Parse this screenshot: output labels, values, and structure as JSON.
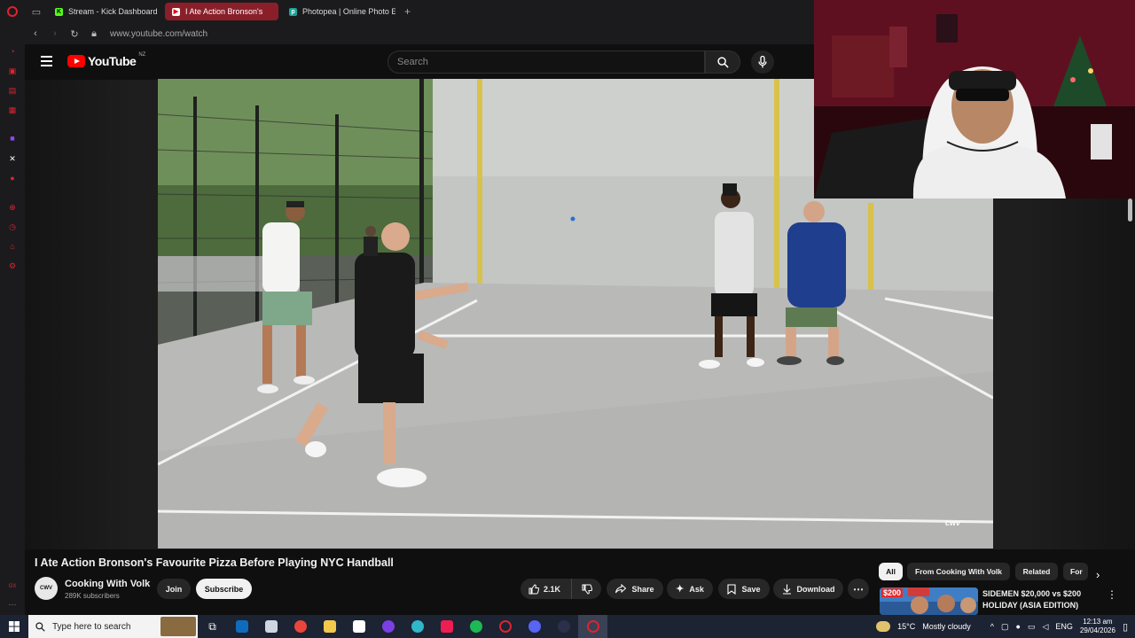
{
  "browser": {
    "tabs": [
      {
        "label": "Stream - Kick Dashboard",
        "icon": "kick-icon",
        "active": false
      },
      {
        "label": "I Ate Action Bronson's",
        "icon": "youtube-icon",
        "active": true
      },
      {
        "label": "Photopea | Online Photo E",
        "icon": "photopea-icon",
        "active": false
      }
    ],
    "new_tab": "+",
    "url": "www.youtube.com/watch",
    "accent": "#e0222f"
  },
  "youtube": {
    "logo_text": "YouTube",
    "region": "NZ",
    "search_placeholder": "Search"
  },
  "video": {
    "title": "I Ate Action Bronson's Favourite Pizza Before Playing NYC Handball",
    "watermark": "cwv",
    "channel": {
      "name": "Cooking With Volk",
      "subscribers": "289K subscribers",
      "avatar_text": "CWV"
    },
    "actions": {
      "join": "Join",
      "subscribe": "Subscribe",
      "likes": "2.1K",
      "share": "Share",
      "ask": "Ask",
      "save": "Save",
      "download": "Download"
    }
  },
  "recommendations": {
    "chips": [
      "All",
      "From Cooking With Volk",
      "Related",
      "For"
    ],
    "first": {
      "badge": "$200",
      "title": "SIDEMEN $20,000 vs $200 HOLIDAY (ASIA EDITION)"
    }
  },
  "taskbar": {
    "search_placeholder": "Type here to search",
    "weather_temp": "15°C",
    "weather_text": "Mostly cloudy",
    "language": "ENG",
    "time": "12:13 am",
    "date": "29/04/2026"
  }
}
